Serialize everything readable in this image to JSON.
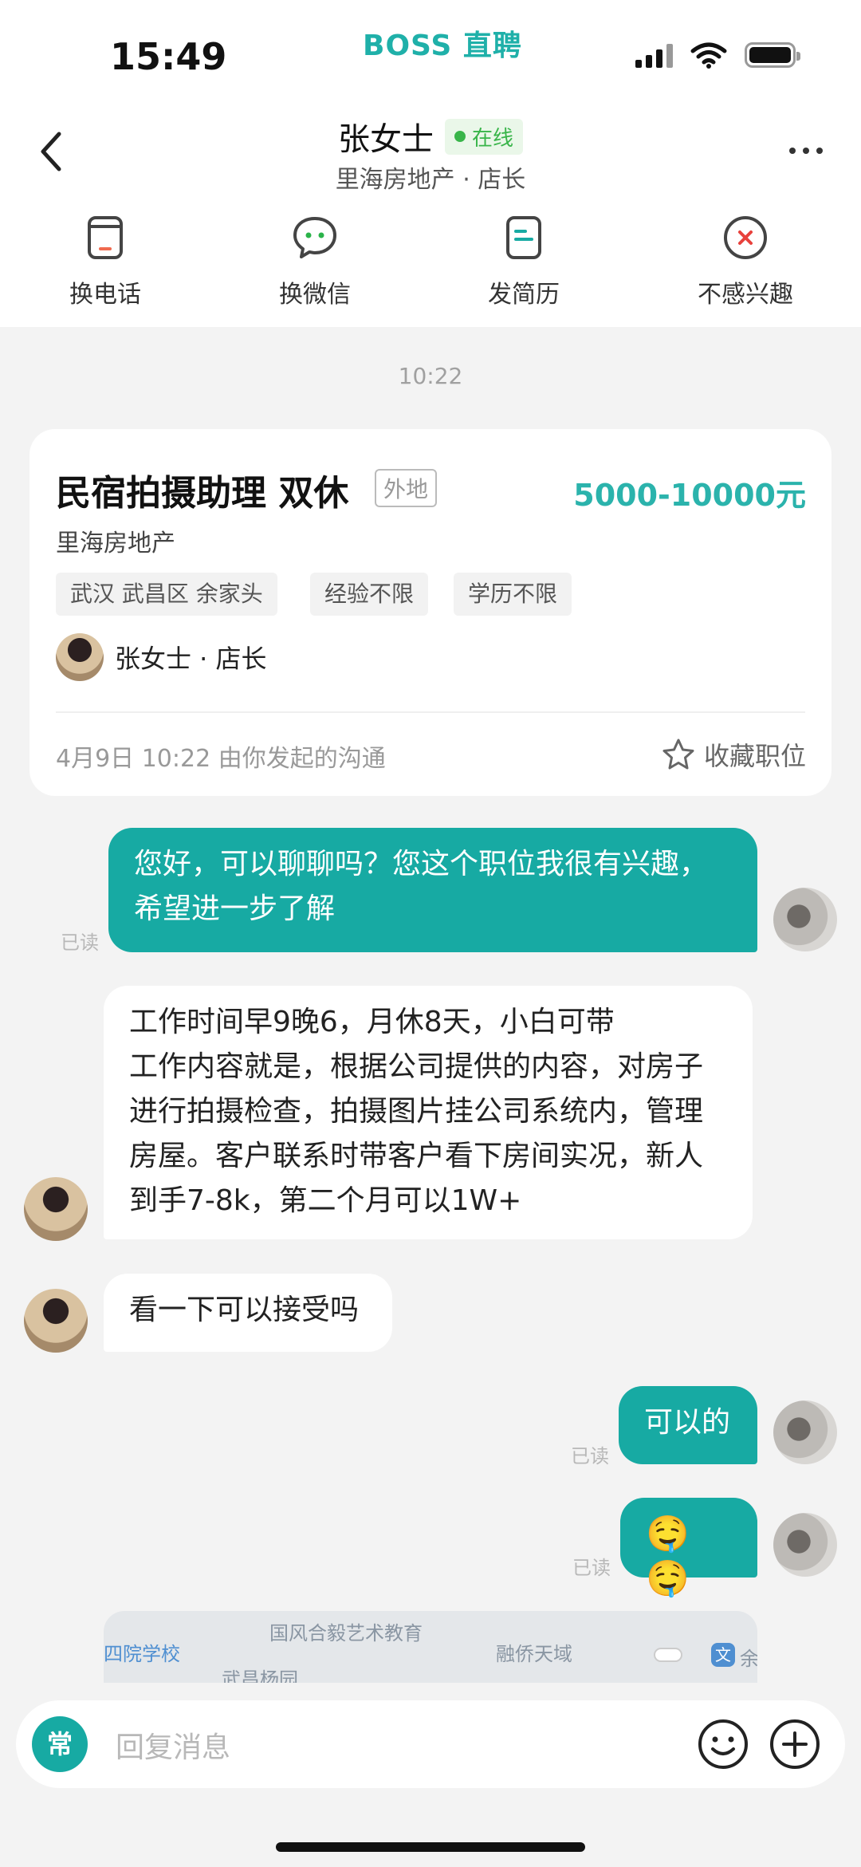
{
  "status_bar": {
    "time": "15:49",
    "app_brand": "BOSS 直聘"
  },
  "header": {
    "name": "张女士",
    "online_label": "在线",
    "subtitle": "里海房地产 · 店长"
  },
  "actions": [
    {
      "label": "换电话",
      "icon": "phone-card-icon"
    },
    {
      "label": "换微信",
      "icon": "wechat-icon"
    },
    {
      "label": "发简历",
      "icon": "resume-icon"
    },
    {
      "label": "不感兴趣",
      "icon": "not-interested-icon"
    }
  ],
  "chat": {
    "start_time": "10:22",
    "job_card": {
      "title": "民宿拍摄助理 双休",
      "tag": "外地",
      "salary": "5000-10000元",
      "company": "里海房地产",
      "chips": [
        "武汉 武昌区 余家头",
        "经验不限",
        "学历不限"
      ],
      "recruiter": "张女士 · 店长",
      "footer": "4月9日 10:22 由你发起的沟通",
      "save_label": "收藏职位"
    },
    "read_label": "已读",
    "messages": [
      {
        "from": "me",
        "lines": [
          "您好，可以聊聊吗？您这个职位我很有兴趣，",
          "希望进一步了解"
        ]
      },
      {
        "from": "her",
        "lines": [
          "工作时间早9晚6，月休8天，小白可带",
          "工作内容就是，根据公司提供的内容，对房子",
          "进行拍摄检查，拍摄图片挂公司系统内，管理",
          "房屋。客户联系时带客户看下房间实况，新人",
          "到手7-8k，第二个月可以1W+"
        ]
      },
      {
        "from": "her",
        "lines": [
          "看一下可以接受吗"
        ]
      },
      {
        "from": "me",
        "lines": [
          "可以的"
        ]
      },
      {
        "from": "me",
        "lines": [
          "🤤🤤"
        ]
      }
    ],
    "map_labels": [
      "四院学校",
      "国风合毅艺术教育",
      "融侨天域",
      "武昌杨园",
      "余"
    ]
  },
  "input": {
    "quick_label": "常",
    "placeholder": "回复消息"
  }
}
